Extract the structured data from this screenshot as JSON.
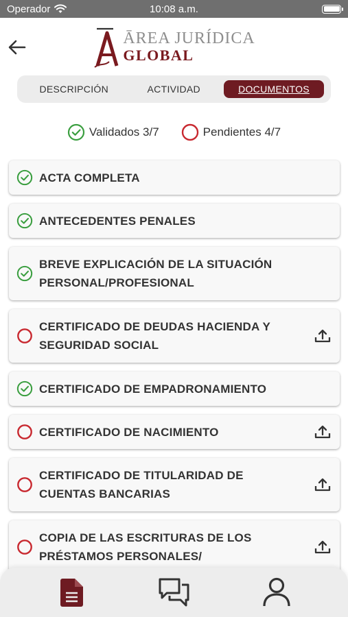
{
  "status_bar": {
    "carrier": "Operador",
    "time": "10:08 a.m."
  },
  "header": {
    "logo_line1": "ĀREA JURÍDICA",
    "logo_line2": "GLOBAL"
  },
  "tabs": [
    {
      "label": "DESCRIPCIÓN",
      "active": false
    },
    {
      "label": "ACTIVIDAD",
      "active": false
    },
    {
      "label": "DOCUMENTOS",
      "active": true
    }
  ],
  "summary": {
    "validated_label": "Validados 3/7",
    "pending_label": "Pendientes 4/7"
  },
  "documents": [
    {
      "line1": "ACTA COMPLETA",
      "line2": "",
      "status": "validated"
    },
    {
      "line1": "ANTECEDENTES PENALES",
      "line2": "",
      "status": "validated"
    },
    {
      "line1": "BREVE EXPLICACIÓN DE LA SITUACIÓN",
      "line2": "PERSONAL/PROFESIONAL",
      "status": "validated"
    },
    {
      "line1": "CERTIFICADO DE DEUDAS HACIENDA Y",
      "line2": "SEGURIDAD SOCIAL",
      "status": "pending"
    },
    {
      "line1": "CERTIFICADO DE EMPADRONAMIENTO",
      "line2": "",
      "status": "validated"
    },
    {
      "line1": "CERTIFICADO DE NACIMIENTO",
      "line2": "",
      "status": "pending"
    },
    {
      "line1": "CERTIFICADO DE TITULARIDAD DE",
      "line2": "CUENTAS BANCARIAS",
      "status": "pending"
    },
    {
      "line1": "COPIA DE LAS ESCRITURAS DE LOS",
      "line2": "PRÉSTAMOS PERSONALES/",
      "status": "pending"
    }
  ],
  "colors": {
    "validated": "#3a9e3f",
    "pending": "#c8282f",
    "brand": "#6e1b22"
  },
  "bottom_nav": [
    {
      "icon": "document-icon",
      "active": true
    },
    {
      "icon": "chat-icon",
      "active": false
    },
    {
      "icon": "user-icon",
      "active": false
    }
  ]
}
